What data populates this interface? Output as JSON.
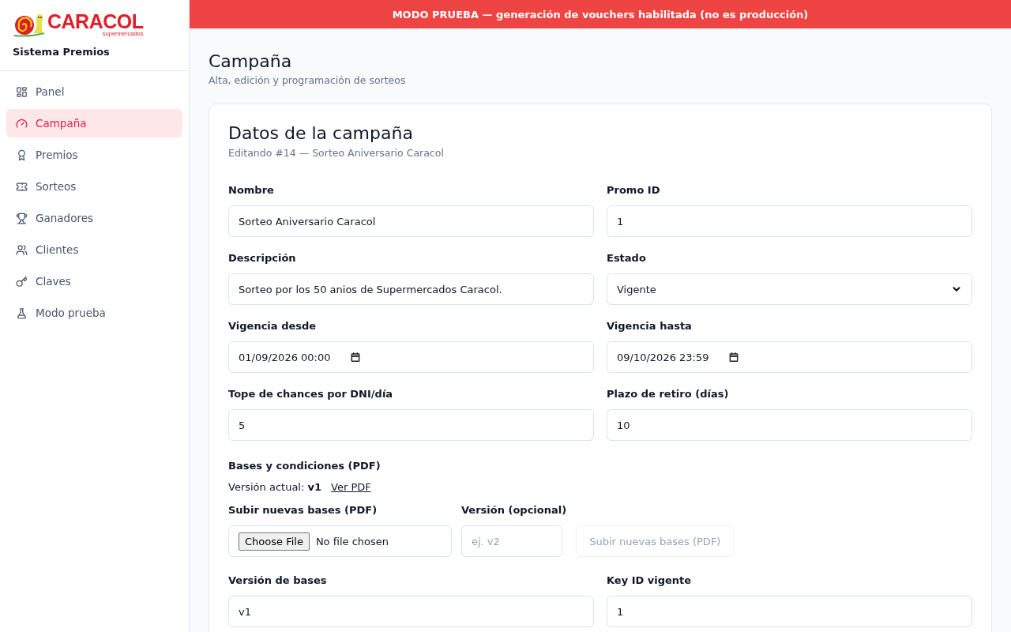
{
  "banner": "MODO PRUEBA — generación de vouchers habilitada (no es producción)",
  "brand": {
    "name": "CARACOL",
    "tagline": "supermercados",
    "app_name": "Sistema Premios"
  },
  "nav": [
    {
      "label": "Panel",
      "selected": false
    },
    {
      "label": "Campaña",
      "selected": true
    },
    {
      "label": "Premios",
      "selected": false
    },
    {
      "label": "Sorteos",
      "selected": false
    },
    {
      "label": "Ganadores",
      "selected": false
    },
    {
      "label": "Clientes",
      "selected": false
    },
    {
      "label": "Claves",
      "selected": false
    },
    {
      "label": "Modo prueba",
      "selected": false
    }
  ],
  "page": {
    "title": "Campaña",
    "subtitle": "Alta, edición y programación de sorteos"
  },
  "card": {
    "title": "Datos de la campaña",
    "subtitle": "Editando #14 — Sorteo Aniversario Caracol",
    "fields": [
      {
        "label": "Nombre",
        "kind": "text",
        "value": "Sorteo Aniversario Caracol"
      },
      {
        "label": "Promo ID",
        "kind": "text",
        "value": "1"
      },
      {
        "label": "Descripción",
        "kind": "text",
        "value": "Sorteo por los 50 anios de Supermercados Caracol."
      },
      {
        "label": "Estado",
        "kind": "select",
        "value": "Vigente"
      },
      {
        "label": "Vigencia desde",
        "kind": "datetime",
        "value": "01/09/2026 00:00"
      },
      {
        "label": "Vigencia hasta",
        "kind": "datetime",
        "value": "09/10/2026 23:59"
      },
      {
        "label": "Tope de chances por DNI/día",
        "kind": "text",
        "value": "5"
      },
      {
        "label": "Plazo de retiro (días)",
        "kind": "text",
        "value": "10"
      }
    ],
    "bases": {
      "title": "Bases y condiciones (PDF)",
      "current_label": "Versión actual:",
      "current_version": "v1",
      "link": "Ver PDF",
      "file_label": "Subir nuevas bases (PDF)",
      "file_button": "Choose File",
      "file_status": "No file chosen",
      "version_label": "Versión (opcional)",
      "version_placeholder": "ej. v2",
      "submit": "Subir nuevas bases (PDF)",
      "submit_disabled": true
    },
    "fields_after": [
      {
        "label": "Versión de bases",
        "kind": "text",
        "value": "v1"
      },
      {
        "label": "Key ID vigente",
        "kind": "text",
        "value": "1"
      }
    ]
  }
}
